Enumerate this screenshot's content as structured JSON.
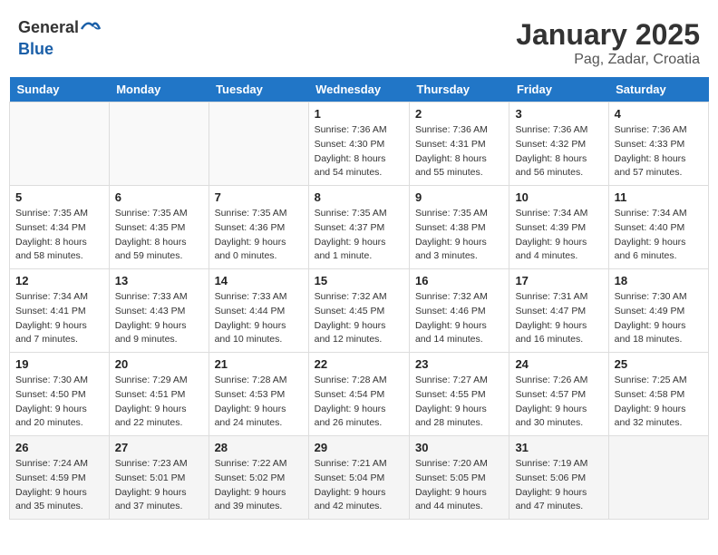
{
  "header": {
    "logo_general": "General",
    "logo_blue": "Blue",
    "month": "January 2025",
    "location": "Pag, Zadar, Croatia"
  },
  "weekdays": [
    "Sunday",
    "Monday",
    "Tuesday",
    "Wednesday",
    "Thursday",
    "Friday",
    "Saturday"
  ],
  "weeks": [
    [
      {
        "day": "",
        "sunrise": "",
        "sunset": "",
        "daylight": ""
      },
      {
        "day": "",
        "sunrise": "",
        "sunset": "",
        "daylight": ""
      },
      {
        "day": "",
        "sunrise": "",
        "sunset": "",
        "daylight": ""
      },
      {
        "day": "1",
        "sunrise": "Sunrise: 7:36 AM",
        "sunset": "Sunset: 4:30 PM",
        "daylight": "Daylight: 8 hours and 54 minutes."
      },
      {
        "day": "2",
        "sunrise": "Sunrise: 7:36 AM",
        "sunset": "Sunset: 4:31 PM",
        "daylight": "Daylight: 8 hours and 55 minutes."
      },
      {
        "day": "3",
        "sunrise": "Sunrise: 7:36 AM",
        "sunset": "Sunset: 4:32 PM",
        "daylight": "Daylight: 8 hours and 56 minutes."
      },
      {
        "day": "4",
        "sunrise": "Sunrise: 7:36 AM",
        "sunset": "Sunset: 4:33 PM",
        "daylight": "Daylight: 8 hours and 57 minutes."
      }
    ],
    [
      {
        "day": "5",
        "sunrise": "Sunrise: 7:35 AM",
        "sunset": "Sunset: 4:34 PM",
        "daylight": "Daylight: 8 hours and 58 minutes."
      },
      {
        "day": "6",
        "sunrise": "Sunrise: 7:35 AM",
        "sunset": "Sunset: 4:35 PM",
        "daylight": "Daylight: 8 hours and 59 minutes."
      },
      {
        "day": "7",
        "sunrise": "Sunrise: 7:35 AM",
        "sunset": "Sunset: 4:36 PM",
        "daylight": "Daylight: 9 hours and 0 minutes."
      },
      {
        "day": "8",
        "sunrise": "Sunrise: 7:35 AM",
        "sunset": "Sunset: 4:37 PM",
        "daylight": "Daylight: 9 hours and 1 minute."
      },
      {
        "day": "9",
        "sunrise": "Sunrise: 7:35 AM",
        "sunset": "Sunset: 4:38 PM",
        "daylight": "Daylight: 9 hours and 3 minutes."
      },
      {
        "day": "10",
        "sunrise": "Sunrise: 7:34 AM",
        "sunset": "Sunset: 4:39 PM",
        "daylight": "Daylight: 9 hours and 4 minutes."
      },
      {
        "day": "11",
        "sunrise": "Sunrise: 7:34 AM",
        "sunset": "Sunset: 4:40 PM",
        "daylight": "Daylight: 9 hours and 6 minutes."
      }
    ],
    [
      {
        "day": "12",
        "sunrise": "Sunrise: 7:34 AM",
        "sunset": "Sunset: 4:41 PM",
        "daylight": "Daylight: 9 hours and 7 minutes."
      },
      {
        "day": "13",
        "sunrise": "Sunrise: 7:33 AM",
        "sunset": "Sunset: 4:43 PM",
        "daylight": "Daylight: 9 hours and 9 minutes."
      },
      {
        "day": "14",
        "sunrise": "Sunrise: 7:33 AM",
        "sunset": "Sunset: 4:44 PM",
        "daylight": "Daylight: 9 hours and 10 minutes."
      },
      {
        "day": "15",
        "sunrise": "Sunrise: 7:32 AM",
        "sunset": "Sunset: 4:45 PM",
        "daylight": "Daylight: 9 hours and 12 minutes."
      },
      {
        "day": "16",
        "sunrise": "Sunrise: 7:32 AM",
        "sunset": "Sunset: 4:46 PM",
        "daylight": "Daylight: 9 hours and 14 minutes."
      },
      {
        "day": "17",
        "sunrise": "Sunrise: 7:31 AM",
        "sunset": "Sunset: 4:47 PM",
        "daylight": "Daylight: 9 hours and 16 minutes."
      },
      {
        "day": "18",
        "sunrise": "Sunrise: 7:30 AM",
        "sunset": "Sunset: 4:49 PM",
        "daylight": "Daylight: 9 hours and 18 minutes."
      }
    ],
    [
      {
        "day": "19",
        "sunrise": "Sunrise: 7:30 AM",
        "sunset": "Sunset: 4:50 PM",
        "daylight": "Daylight: 9 hours and 20 minutes."
      },
      {
        "day": "20",
        "sunrise": "Sunrise: 7:29 AM",
        "sunset": "Sunset: 4:51 PM",
        "daylight": "Daylight: 9 hours and 22 minutes."
      },
      {
        "day": "21",
        "sunrise": "Sunrise: 7:28 AM",
        "sunset": "Sunset: 4:53 PM",
        "daylight": "Daylight: 9 hours and 24 minutes."
      },
      {
        "day": "22",
        "sunrise": "Sunrise: 7:28 AM",
        "sunset": "Sunset: 4:54 PM",
        "daylight": "Daylight: 9 hours and 26 minutes."
      },
      {
        "day": "23",
        "sunrise": "Sunrise: 7:27 AM",
        "sunset": "Sunset: 4:55 PM",
        "daylight": "Daylight: 9 hours and 28 minutes."
      },
      {
        "day": "24",
        "sunrise": "Sunrise: 7:26 AM",
        "sunset": "Sunset: 4:57 PM",
        "daylight": "Daylight: 9 hours and 30 minutes."
      },
      {
        "day": "25",
        "sunrise": "Sunrise: 7:25 AM",
        "sunset": "Sunset: 4:58 PM",
        "daylight": "Daylight: 9 hours and 32 minutes."
      }
    ],
    [
      {
        "day": "26",
        "sunrise": "Sunrise: 7:24 AM",
        "sunset": "Sunset: 4:59 PM",
        "daylight": "Daylight: 9 hours and 35 minutes."
      },
      {
        "day": "27",
        "sunrise": "Sunrise: 7:23 AM",
        "sunset": "Sunset: 5:01 PM",
        "daylight": "Daylight: 9 hours and 37 minutes."
      },
      {
        "day": "28",
        "sunrise": "Sunrise: 7:22 AM",
        "sunset": "Sunset: 5:02 PM",
        "daylight": "Daylight: 9 hours and 39 minutes."
      },
      {
        "day": "29",
        "sunrise": "Sunrise: 7:21 AM",
        "sunset": "Sunset: 5:04 PM",
        "daylight": "Daylight: 9 hours and 42 minutes."
      },
      {
        "day": "30",
        "sunrise": "Sunrise: 7:20 AM",
        "sunset": "Sunset: 5:05 PM",
        "daylight": "Daylight: 9 hours and 44 minutes."
      },
      {
        "day": "31",
        "sunrise": "Sunrise: 7:19 AM",
        "sunset": "Sunset: 5:06 PM",
        "daylight": "Daylight: 9 hours and 47 minutes."
      },
      {
        "day": "",
        "sunrise": "",
        "sunset": "",
        "daylight": ""
      }
    ]
  ]
}
